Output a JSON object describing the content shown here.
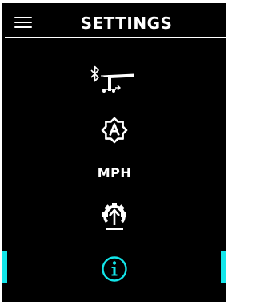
{
  "header": {
    "title": "SETTINGS",
    "menu_icon": "hamburger-menu-icon"
  },
  "menu": {
    "items": [
      {
        "icon": "bluetooth-kickscooter-icon"
      },
      {
        "icon": "auto-gear-icon"
      },
      {
        "label": "MPH"
      },
      {
        "icon": "firmware-update-gear-icon"
      },
      {
        "icon": "info-icon",
        "selected": true
      }
    ]
  },
  "colors": {
    "background": "#000000",
    "foreground": "#ffffff",
    "accent": "#13e6ea"
  }
}
